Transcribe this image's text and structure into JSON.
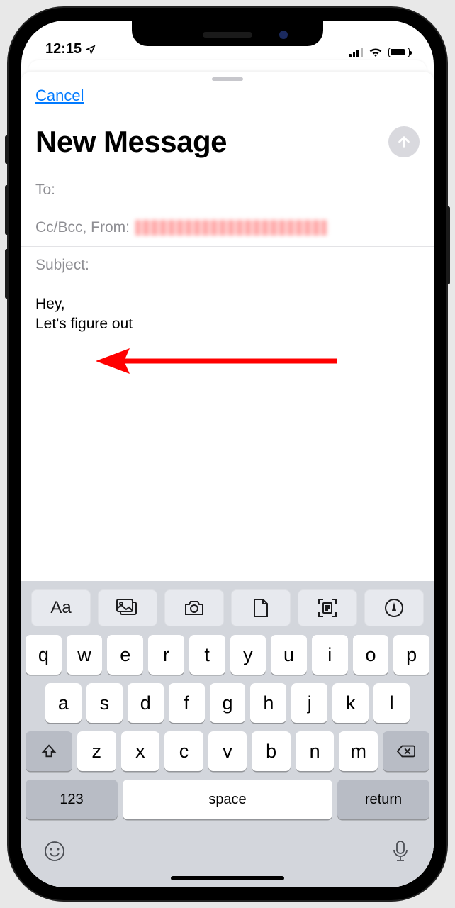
{
  "status": {
    "time": "12:15"
  },
  "header": {
    "cancel": "Cancel",
    "title": "New Message"
  },
  "fields": {
    "to_label": "To:",
    "to_value": "",
    "cc_label": "Cc/Bcc, From:",
    "subject_label": "Subject:",
    "subject_value": ""
  },
  "body": {
    "line1": "Hey,",
    "line2": "Let's figure out"
  },
  "format_bar": {
    "items": [
      "format-text",
      "photos",
      "camera",
      "attachment",
      "scan-document",
      "markup"
    ]
  },
  "keyboard": {
    "row1": [
      "q",
      "w",
      "e",
      "r",
      "t",
      "y",
      "u",
      "i",
      "o",
      "p"
    ],
    "row2": [
      "a",
      "s",
      "d",
      "f",
      "g",
      "h",
      "j",
      "k",
      "l"
    ],
    "row3": [
      "z",
      "x",
      "c",
      "v",
      "b",
      "n",
      "m"
    ],
    "num": "123",
    "space": "space",
    "return": "return"
  }
}
